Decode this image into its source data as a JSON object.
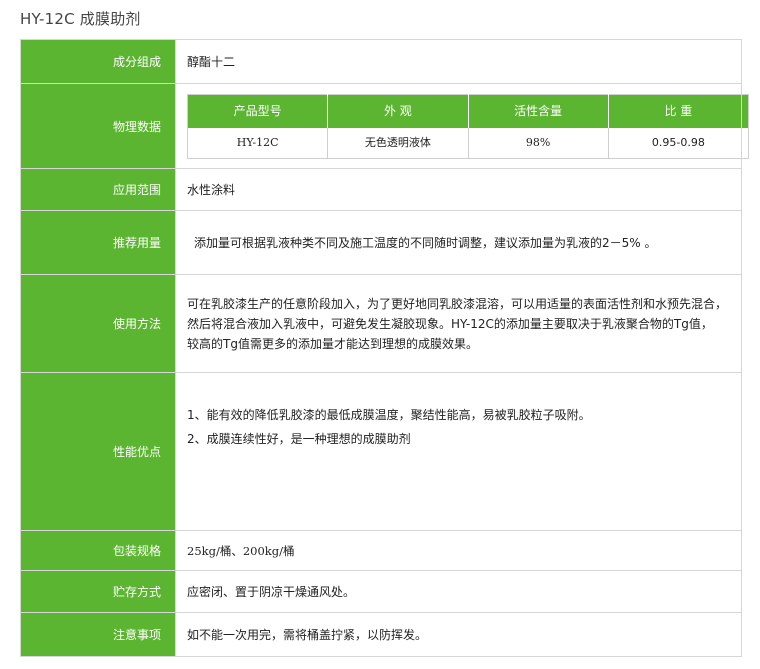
{
  "page_title": "HY-12C 成膜助剂",
  "rows": {
    "composition": {
      "label": "成分组成",
      "value": "醇酯十二"
    },
    "physical": {
      "label": "物理数据",
      "headers": [
        "产品型号",
        "外  观",
        "活性含量",
        "比  重"
      ],
      "values": [
        "HY-12C",
        "无色透明液体",
        "98%",
        "0.95-0.98"
      ]
    },
    "application": {
      "label": "应用范围",
      "value": "水性涂料"
    },
    "dosage": {
      "label": "推荐用量",
      "value": "添加量可根据乳液种类不同及施工温度的不同随时调整，建议添加量为乳液的2－5% 。"
    },
    "usage": {
      "label": "使用方法",
      "lines": [
        "可在乳胶漆生产的任意阶段加入，为了更好地同乳胶漆混溶，可以用适量的表面活性剂和水预先混合，",
        "然后将混合液加入乳液中，可避免发生凝胶现象。HY-12C的添加量主要取决于乳液聚合物的Tg值，",
        "较高的Tg值需更多的添加量才能达到理想的成膜效果。"
      ]
    },
    "advantages": {
      "label": "性能优点",
      "lines": [
        "1、能有效的降低乳胶漆的最低成膜温度，聚结性能高，易被乳胶粒子吸附。",
        "2、成膜连续性好，是一种理想的成膜助剂"
      ]
    },
    "packaging": {
      "label": "包装规格",
      "value": "25kg/桶、200kg/桶"
    },
    "storage": {
      "label": "贮存方式",
      "value": "应密闭、置于阴凉干燥通风处。"
    },
    "notes": {
      "label": "注意事项",
      "value": "如不能一次用完，需将桶盖拧紧，以防挥发。"
    }
  },
  "colors": {
    "label_bg": "#5cb531",
    "border": "#d6d6d6"
  }
}
